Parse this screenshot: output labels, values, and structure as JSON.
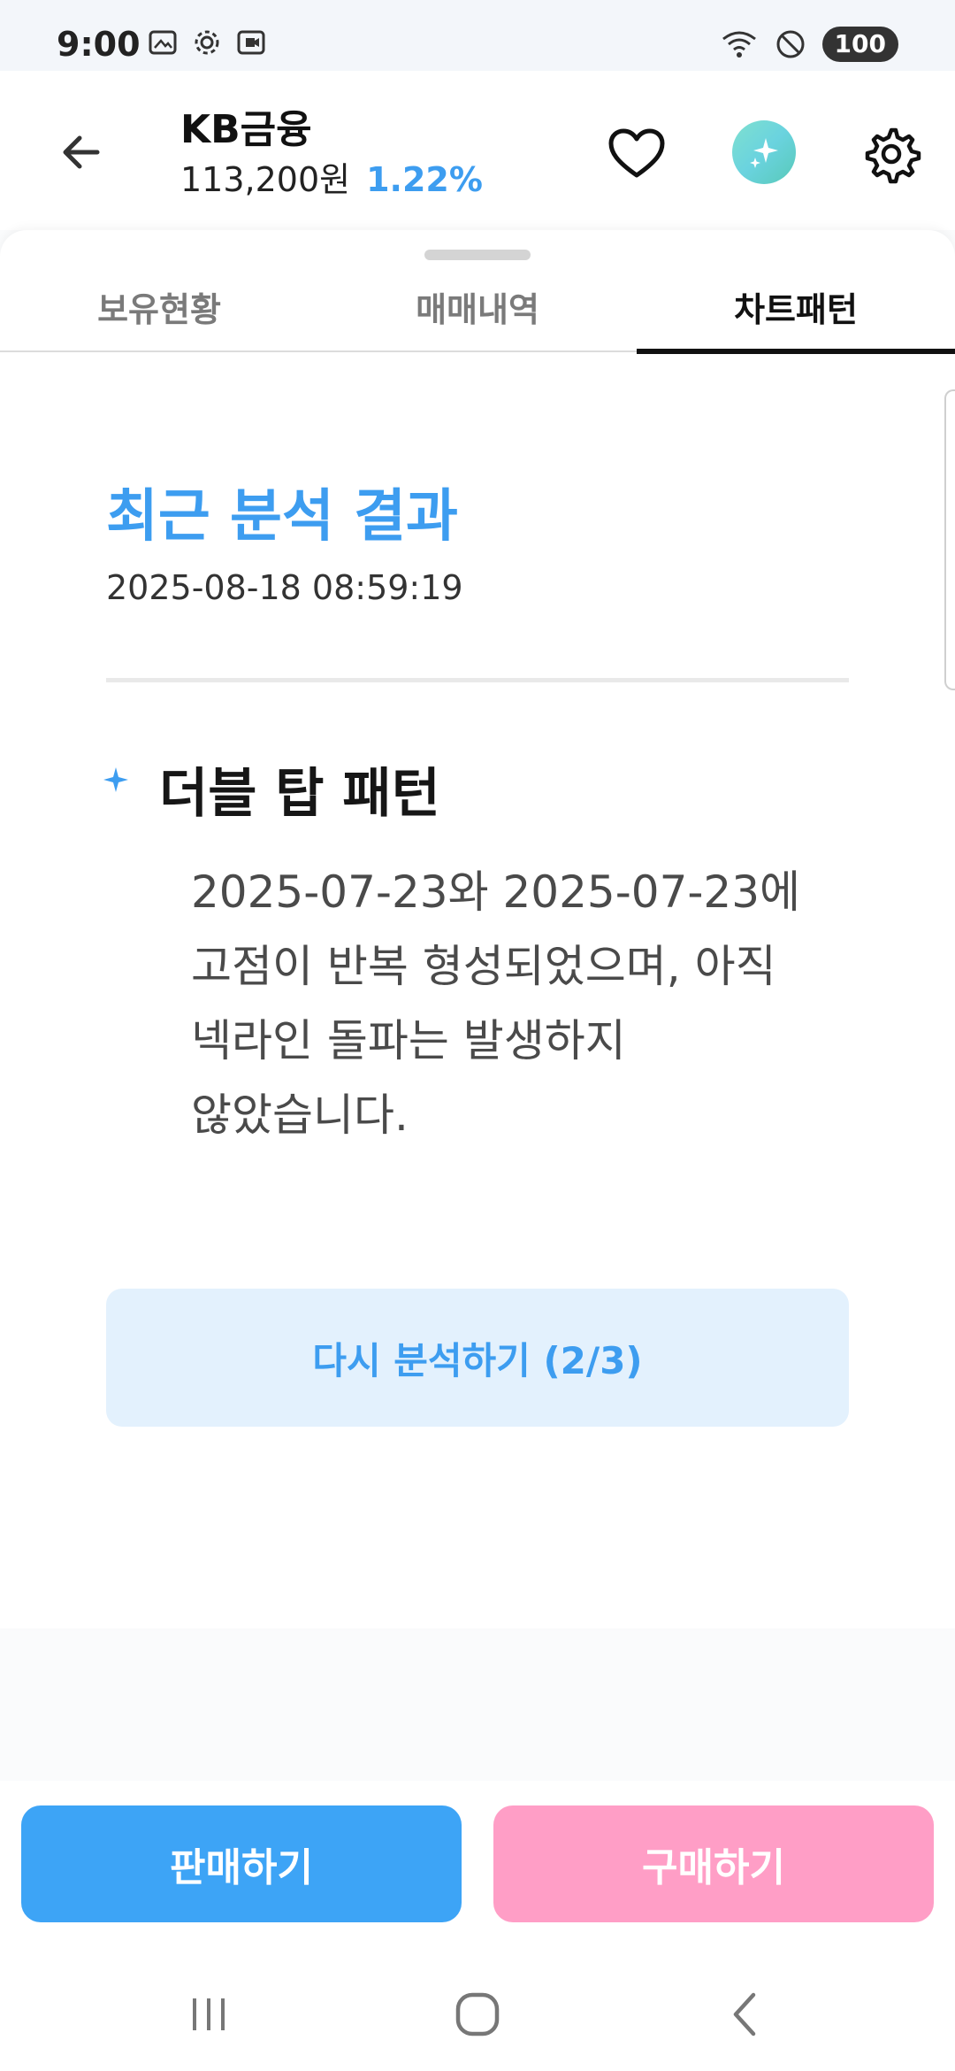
{
  "status_bar": {
    "time": "9:00",
    "battery": "100",
    "left_icons": [
      "image-capture-icon",
      "gear-icon",
      "screen-record-icon"
    ],
    "right_icons": [
      "wifi-icon",
      "dnd-icon"
    ]
  },
  "header": {
    "stock_name": "KB금융",
    "price": "113,200원",
    "change": "1.22%"
  },
  "tabs": [
    {
      "label": "보유현황"
    },
    {
      "label": "매매내역"
    },
    {
      "label": "차트패턴"
    }
  ],
  "active_tab": "차트패턴",
  "analysis": {
    "title": "최근 분석 결과",
    "timestamp": "2025-08-18 08:59:19",
    "pattern_name": "더블 탑 패턴",
    "pattern_description": "2025-07-23와 2025-07-23에 고점이 반복 형성되었으며, 아직 넥라인 돌파는 발생하지 않았습니다.",
    "reanalyze_label": "다시 분석하기 (2/3)"
  },
  "actions": {
    "sell_label": "판매하기",
    "buy_label": "구매하기"
  },
  "colors": {
    "accent_blue": "#3d9df0",
    "sell": "#3da4f6",
    "buy": "#ff9ec6",
    "reanalyze_bg": "#e3f1fd"
  }
}
